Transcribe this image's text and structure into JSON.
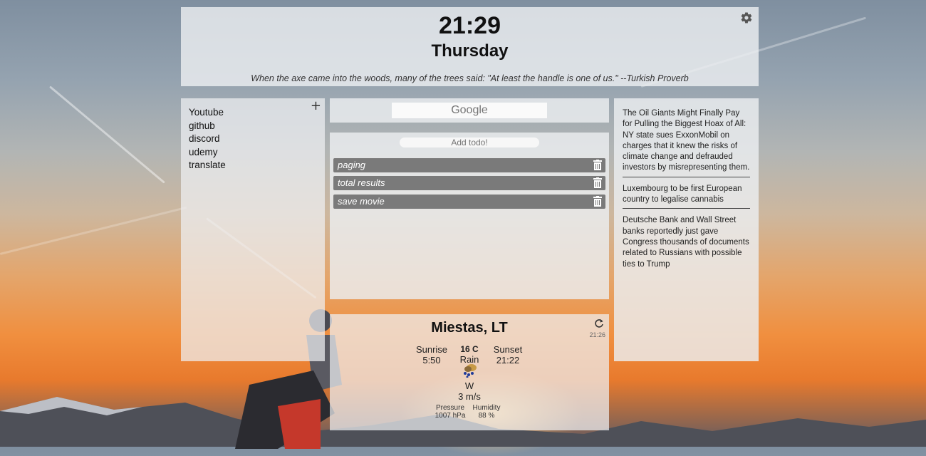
{
  "header": {
    "time": "21:29",
    "weekday": "Thursday",
    "quote": "When the axe came into the woods, many of the trees said: \"At least the handle is one of us.\" --Turkish Proverb"
  },
  "links": {
    "items": [
      {
        "label": "Youtube"
      },
      {
        "label": "github"
      },
      {
        "label": "discord"
      },
      {
        "label": "udemy"
      },
      {
        "label": "translate"
      }
    ],
    "add_label": "+"
  },
  "search": {
    "placeholder": "Google"
  },
  "todo": {
    "input_placeholder": "Add todo!",
    "items": [
      {
        "text": "paging"
      },
      {
        "text": "total results"
      },
      {
        "text": "save movie"
      }
    ]
  },
  "weather": {
    "city": "Miestas, LT",
    "updated": "21:26",
    "sunrise_label": "Sunrise",
    "sunrise": "5:50",
    "sunset_label": "Sunset",
    "sunset": "21:22",
    "temperature": "16 C",
    "condition": "Rain",
    "wind_dir": "W",
    "wind_speed": "3 m/s",
    "pressure_label": "Pressure",
    "pressure": "1007 hPa",
    "humidity_label": "Humidity",
    "humidity": "88 %"
  },
  "news": {
    "items": [
      {
        "text": "The Oil Giants Might Finally Pay for Pulling the Biggest Hoax of All: NY state sues ExxonMobil on charges that it knew the risks of climate change and defrauded investors by misrepresenting them."
      },
      {
        "text": "Luxembourg to be first European country to legalise cannabis"
      },
      {
        "text": "Deutsche Bank and Wall Street banks reportedly just gave Congress thousands of documents related to Russians with possible ties to Trump"
      }
    ]
  }
}
